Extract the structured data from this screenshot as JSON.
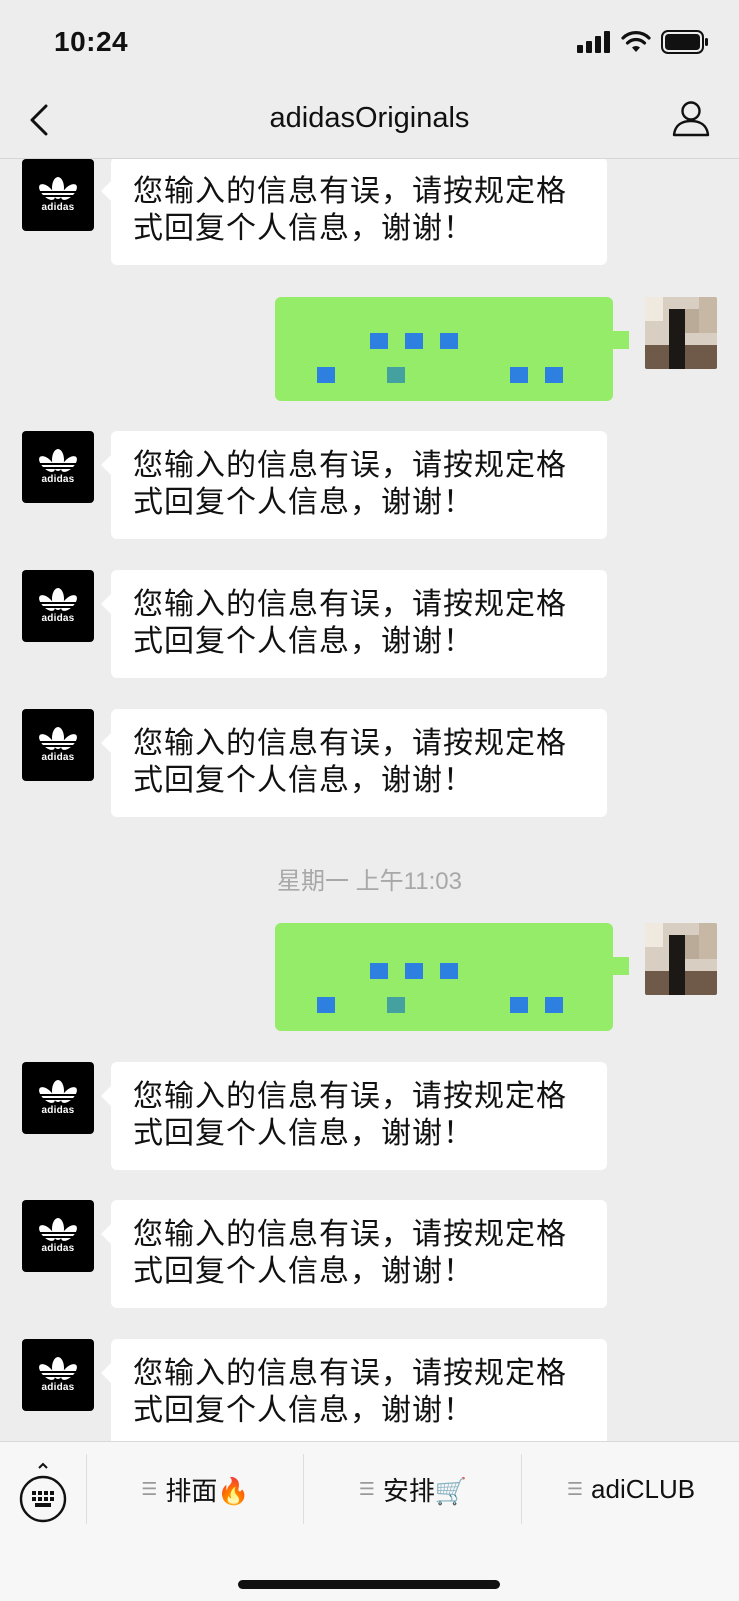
{
  "status_bar": {
    "time": "10:24",
    "icons": [
      "signal-icon",
      "wifi-icon",
      "battery-icon"
    ]
  },
  "nav": {
    "title": "adidasOriginals",
    "back_icon": "chevron-left-icon",
    "profile_icon": "person-icon"
  },
  "chat": {
    "brand_logo_text": "adidas",
    "auto_reply": "您输入的信息有误，请按规定格式回复个人信息，谢谢！",
    "timestamp": "星期一 上午11:03"
  },
  "menu": {
    "keyboard_icon": "keyboard-icon",
    "items": [
      {
        "label": "排面🔥"
      },
      {
        "label": "安排🛒"
      },
      {
        "label": "adiCLUB"
      }
    ]
  },
  "colors": {
    "background": "#ededed",
    "sent_bubble": "#95ec69",
    "received_bubble": "#ffffff"
  }
}
